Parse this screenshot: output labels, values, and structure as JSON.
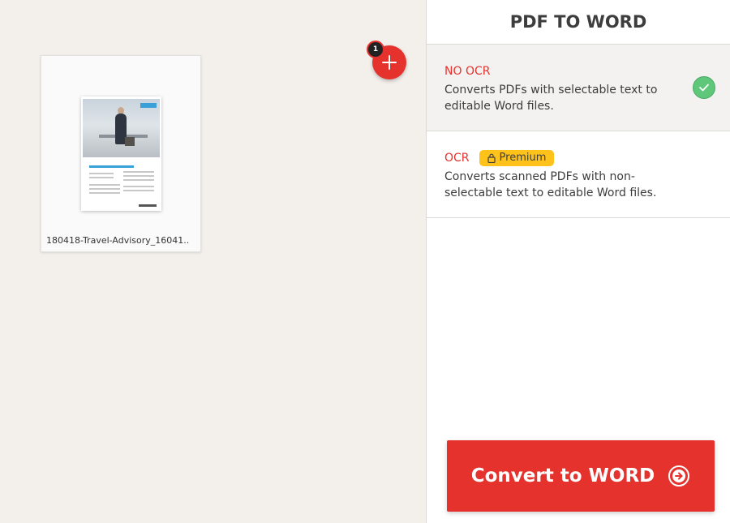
{
  "workspace": {
    "files": [
      {
        "name": "180418-Travel-Advisory_16041.."
      }
    ],
    "add_button": {
      "badge_count": "1",
      "icon": "plus-icon"
    }
  },
  "panel": {
    "title": "PDF TO WORD",
    "options": [
      {
        "title": "NO OCR",
        "description": "Converts PDFs with selectable text to editable Word files.",
        "selected": true,
        "icon": "check-icon"
      },
      {
        "title": "OCR",
        "badge": "Premium",
        "badge_icon": "lock-icon",
        "description": "Converts scanned PDFs with non-selectable text to editable Word files.",
        "selected": false
      }
    ],
    "convert_button": {
      "label": "Convert to WORD",
      "icon": "arrow-circle-right-icon"
    }
  },
  "colors": {
    "accent": "#e5322d",
    "success": "#5ec77a",
    "premium": "#ffc21a",
    "workspace_bg": "#f3f0ec"
  }
}
